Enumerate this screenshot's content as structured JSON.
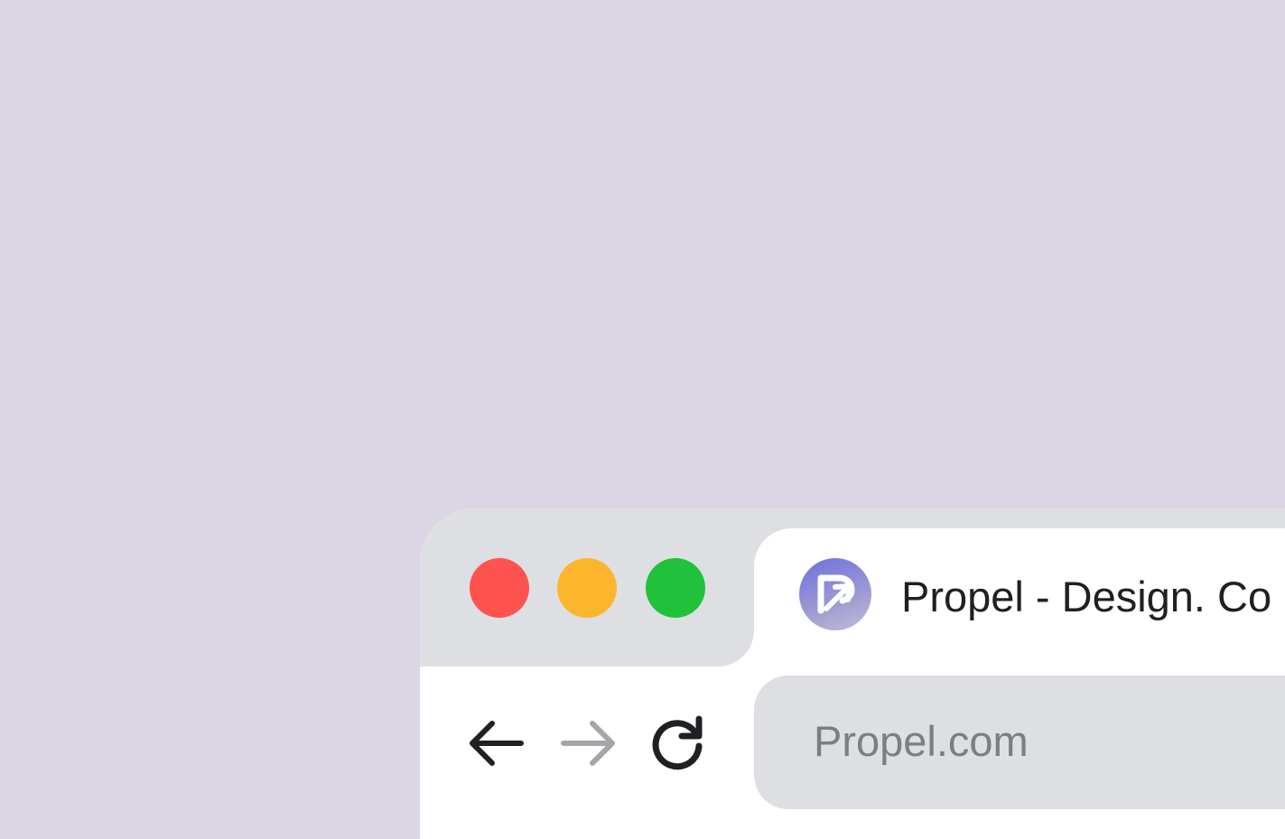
{
  "window": {
    "controls": {
      "close": {
        "icon": "close-dot",
        "color": "#ff5350"
      },
      "minimize": {
        "icon": "minimize-dot",
        "color": "#fdb52d"
      },
      "maximize": {
        "icon": "maximize-dot",
        "color": "#1fc23a"
      }
    }
  },
  "tab": {
    "favicon": "propel-logo",
    "title": "Propel - Design. Co"
  },
  "navigation": {
    "back_icon": "arrow-left-icon",
    "forward_icon": "arrow-right-icon",
    "reload_icon": "reload-icon"
  },
  "address_bar": {
    "url": "Propel.com"
  },
  "colors": {
    "background": "#dbd5e4",
    "chrome": "#dddfe3",
    "tab": "#ffffff",
    "text": "#1f2023",
    "url_text": "#7c7e83",
    "forward_disabled": "#a5a6a9"
  }
}
